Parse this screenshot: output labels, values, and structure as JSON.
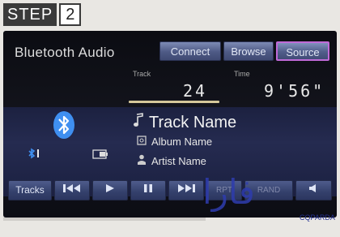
{
  "step": {
    "word": "STEP",
    "number": "2"
  },
  "screen": {
    "title": "Bluetooth Audio",
    "buttons": {
      "connect": "Connect",
      "browse": "Browse",
      "source": "Source"
    },
    "track_label": "Track",
    "track_number": "24",
    "time_label": "Time",
    "time_value": "9'56\"",
    "track_name": "Track Name",
    "album_name": "Album Name",
    "artist_name": "Artist Name",
    "controls": {
      "tracks": "Tracks",
      "rpt": "RPT",
      "rand": "RAND"
    },
    "progress_fraction": 0.45
  },
  "colors": {
    "accent_selected": "#c06ad8",
    "button_blue": "#4e5a85",
    "bluetooth_blue": "#3f8ff0",
    "watermark": "#2e3cae"
  },
  "watermark": {
    "text": "فارا",
    "tag": "CQPARDA"
  }
}
